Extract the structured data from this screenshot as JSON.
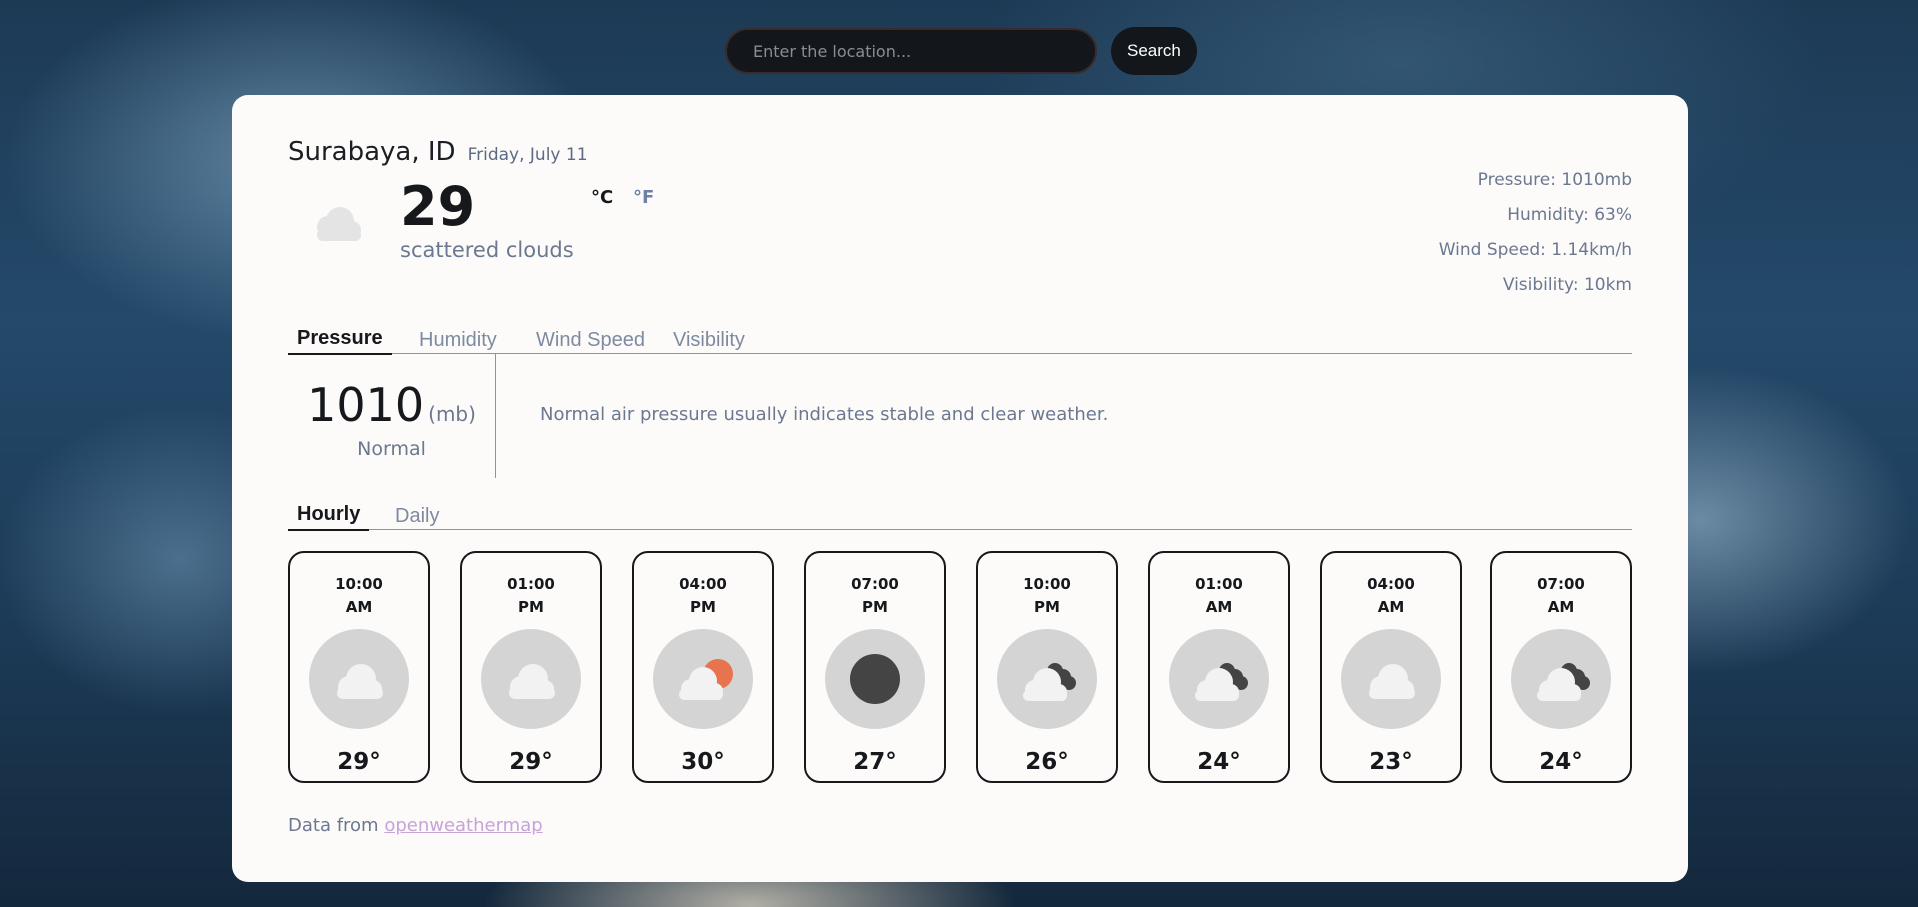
{
  "search": {
    "placeholder": "Enter the location...",
    "button_label": "Search"
  },
  "location": {
    "city": "Surabaya, ID",
    "date": "Friday, July 11"
  },
  "current": {
    "icon": "cloud-icon",
    "temperature": "29",
    "description": "scattered clouds",
    "unit_celsius": "°C",
    "unit_fahrenheit": "°F"
  },
  "stats": {
    "pressure": "Pressure: 1010mb",
    "humidity": "Humidity: 63%",
    "wind_speed": "Wind Speed: 1.14km/h",
    "visibility": "Visibility: 10km"
  },
  "metric_tabs": [
    "Pressure",
    "Humidity",
    "Wind Speed",
    "Visibility"
  ],
  "metric_detail": {
    "value": "1010",
    "unit": "(mb)",
    "status": "Normal",
    "description": "Normal air pressure usually indicates stable and clear weather."
  },
  "forecast_tabs": [
    "Hourly",
    "Daily"
  ],
  "hourly": [
    {
      "time": "10:00",
      "period": "AM",
      "icon": "cloud-icon",
      "temp": "29°"
    },
    {
      "time": "01:00",
      "period": "PM",
      "icon": "cloud-icon",
      "temp": "29°"
    },
    {
      "time": "04:00",
      "period": "PM",
      "icon": "sun-cloud-icon",
      "temp": "30°"
    },
    {
      "time": "07:00",
      "period": "PM",
      "icon": "moon-icon",
      "temp": "27°"
    },
    {
      "time": "10:00",
      "period": "PM",
      "icon": "dark-cloud-icon",
      "temp": "26°"
    },
    {
      "time": "01:00",
      "period": "AM",
      "icon": "dark-cloud-icon",
      "temp": "24°"
    },
    {
      "time": "04:00",
      "period": "AM",
      "icon": "cloud-icon",
      "temp": "23°"
    },
    {
      "time": "07:00",
      "period": "AM",
      "icon": "dark-cloud-icon",
      "temp": "24°"
    }
  ],
  "footer": {
    "prefix": "Data from ",
    "link_text": "openweathermap"
  },
  "colors": {
    "card_background": "#fcfbf9",
    "text_primary": "#16181c",
    "text_muted": "#6b7890",
    "link": "#c7a3d9",
    "icon_circle": "#d4d4d4",
    "sun": "#e8744f"
  }
}
